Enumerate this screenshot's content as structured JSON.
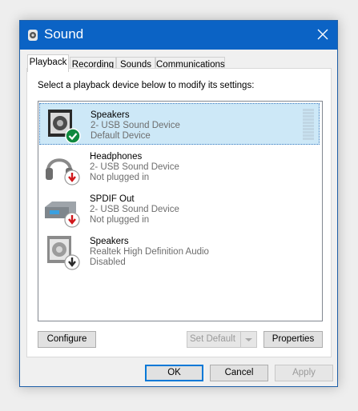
{
  "window": {
    "title": "Sound",
    "app_icon": "speaker-icon",
    "close_icon": "close-icon"
  },
  "tabs": [
    {
      "label": "Playback",
      "active": true
    },
    {
      "label": "Recording",
      "active": false
    },
    {
      "label": "Sounds",
      "active": false
    },
    {
      "label": "Communications",
      "active": false
    }
  ],
  "instruction": "Select a playback device below to modify its settings:",
  "devices": [
    {
      "name": "Speakers",
      "description": "2- USB Sound Device",
      "status": "Default Device",
      "icon": "speaker-icon",
      "badge": "check-icon",
      "selected": true
    },
    {
      "name": "Headphones",
      "description": "2- USB Sound Device",
      "status": "Not plugged in",
      "icon": "headphones-icon",
      "badge": "unplugged-arrow-icon",
      "selected": false
    },
    {
      "name": "SPDIF Out",
      "description": "2- USB Sound Device",
      "status": "Not plugged in",
      "icon": "spdif-icon",
      "badge": "unplugged-arrow-icon",
      "selected": false
    },
    {
      "name": "Speakers",
      "description": "Realtek High Definition Audio",
      "status": "Disabled",
      "icon": "speaker-icon",
      "badge": "disabled-arrow-icon",
      "selected": false
    }
  ],
  "buttons": {
    "configure": "Configure",
    "set_default": "Set Default",
    "properties": "Properties",
    "ok": "OK",
    "cancel": "Cancel",
    "apply": "Apply"
  },
  "colors": {
    "titlebar": "#0b63c5",
    "selection": "#cde8f7",
    "badge_ok": "#10893e",
    "badge_unplugged": "#d0171b"
  }
}
